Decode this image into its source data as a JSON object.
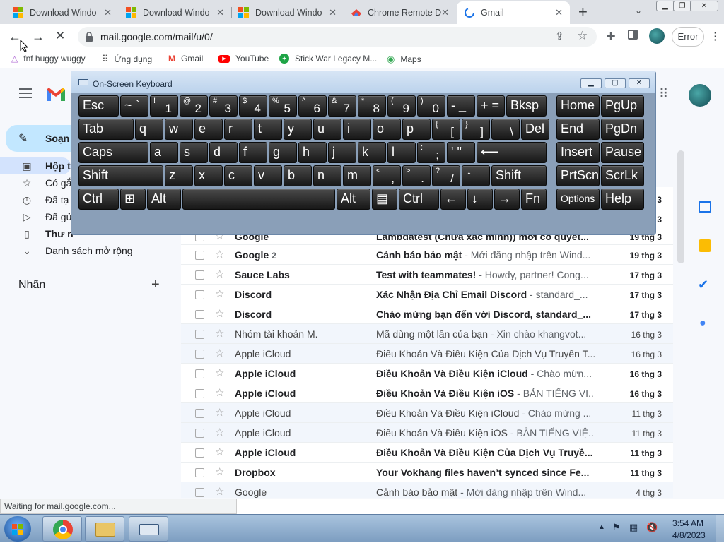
{
  "tabs": [
    {
      "title": "Download Windo",
      "icon": "windows-logo-icon"
    },
    {
      "title": "Download Windo",
      "icon": "windows-logo-icon"
    },
    {
      "title": "Download Windo",
      "icon": "windows-logo-icon"
    },
    {
      "title": "Chrome Remote D",
      "icon": "chrome-remote-icon"
    },
    {
      "title": "Gmail",
      "icon": "loading-spinner-icon"
    }
  ],
  "new_tab": "+",
  "toolbar": {
    "url": "mail.google.com/mail/u/0/",
    "profile_button": "Error"
  },
  "bookmarks": [
    {
      "label": "fnf huggy wuggy",
      "icon": "triangle-icon"
    },
    {
      "label": "Ứng dụng",
      "icon": "apps-grid-icon"
    },
    {
      "label": "Gmail",
      "icon": "gmail-icon"
    },
    {
      "label": "YouTube",
      "icon": "youtube-icon"
    },
    {
      "label": "Stick War Legacy M...",
      "icon": "game-icon"
    },
    {
      "label": "Maps",
      "icon": "maps-icon"
    }
  ],
  "gmail": {
    "compose": "Soạn",
    "nav": [
      {
        "label": "Hộp t",
        "icon": "inbox-icon",
        "bold": true
      },
      {
        "label": "Có gắ",
        "icon": "star-icon"
      },
      {
        "label": "Đã tạ",
        "icon": "clock-icon"
      },
      {
        "label": "Đã gử",
        "icon": "send-icon"
      },
      {
        "label": "Thư n",
        "icon": "draft-icon",
        "bold": true
      },
      {
        "label": "Danh sách mở rộng",
        "icon": "chevron-down-icon"
      }
    ],
    "labels_heading": "Nhãn",
    "partial_top_rows": [
      {
        "snd": "Google",
        "msg": "Lambdatest (Chưa xác minh)) mời cô quyết...",
        "dt": "19 thg 3"
      }
    ],
    "emails": [
      {
        "sender": "Google",
        "count": "2",
        "subject": "Cảnh báo bảo mật",
        "preview": " - Mới đăng nhập trên Wind...",
        "date": "19 thg 3",
        "unread": true
      },
      {
        "sender": "Sauce Labs",
        "count": "",
        "subject": "Test with teammates!",
        "preview": " - Howdy, partner! Cong...",
        "date": "17 thg 3",
        "unread": true
      },
      {
        "sender": "Discord",
        "count": "",
        "subject": "Xác Nhận Địa Chỉ Email Discord",
        "preview": " - standard_...",
        "date": "17 thg 3",
        "unread": true
      },
      {
        "sender": "Discord",
        "count": "",
        "subject": "Chào mừng bạn đến với Discord, standard_...",
        "preview": "",
        "date": "17 thg 3",
        "unread": true
      },
      {
        "sender": "Nhóm tài khoản M.",
        "count": "",
        "subject": "Mã dùng một lần của bạn",
        "preview": " - Xin chào khangvot...",
        "date": "16 thg 3",
        "unread": false
      },
      {
        "sender": "Apple iCloud",
        "count": "",
        "subject": "Điều Khoản Và Điều Kiện Của Dịch Vụ Truyền T...",
        "preview": "",
        "date": "16 thg 3",
        "unread": false
      },
      {
        "sender": "Apple iCloud",
        "count": "",
        "subject": "Điều Khoản Và Điều Kiện iCloud",
        "preview": " - Chào mừn...",
        "date": "16 thg 3",
        "unread": true
      },
      {
        "sender": "Apple iCloud",
        "count": "",
        "subject": "Điều Khoản Và Điều Kiện iOS",
        "preview": " - BẢN TIẾNG VI...",
        "date": "16 thg 3",
        "unread": true
      },
      {
        "sender": "Apple iCloud",
        "count": "",
        "subject": "Điều Khoản Và Điều Kiện iCloud",
        "preview": " - Chào mừng ...",
        "date": "11 thg 3",
        "unread": false
      },
      {
        "sender": "Apple iCloud",
        "count": "",
        "subject": "Điều Khoản Và Điều Kiện iOS",
        "preview": " - BẢN TIẾNG VIỆ...",
        "date": "11 thg 3",
        "unread": false
      },
      {
        "sender": "Apple iCloud",
        "count": "",
        "subject": "Điều Khoản Và Điều Kiện Của Dịch Vụ Truyề...",
        "preview": "",
        "date": "11 thg 3",
        "unread": true
      },
      {
        "sender": "Dropbox",
        "count": "",
        "subject": "Your Vokhang files haven’t synced since Fe...",
        "preview": "",
        "date": "11 thg 3",
        "unread": true
      },
      {
        "sender": "Google",
        "count": "",
        "subject": "Cảnh báo bảo mật",
        "preview": " - Mới đăng nhập trên Wind...",
        "date": "4 thg 3",
        "unread": false
      }
    ],
    "hidden_dates": [
      "17 thg 3",
      "17 thg 3",
      "17 thg 3"
    ]
  },
  "osk": {
    "title": "On-Screen Keyboard",
    "rows": [
      [
        [
          "Esc",
          ""
        ],
        [
          "~ `",
          ""
        ],
        [
          "1",
          "!"
        ],
        [
          "2",
          "@"
        ],
        [
          "3",
          "#"
        ],
        [
          "4",
          "$"
        ],
        [
          "5",
          "%"
        ],
        [
          "6",
          "^"
        ],
        [
          "7",
          "&"
        ],
        [
          "8",
          "*"
        ],
        [
          "9",
          "("
        ],
        [
          "0",
          ")"
        ],
        [
          "- _",
          ""
        ],
        [
          "+ =",
          ""
        ],
        [
          "Bksp",
          ""
        ],
        [
          "Home",
          ""
        ],
        [
          "PgUp",
          ""
        ]
      ],
      [
        [
          "Tab",
          ""
        ],
        [
          "q",
          ""
        ],
        [
          "w",
          ""
        ],
        [
          "e",
          ""
        ],
        [
          "r",
          ""
        ],
        [
          "t",
          ""
        ],
        [
          "y",
          ""
        ],
        [
          "u",
          ""
        ],
        [
          "i",
          ""
        ],
        [
          "o",
          ""
        ],
        [
          "p",
          ""
        ],
        [
          "[",
          "{"
        ],
        [
          "]",
          "}"
        ],
        [
          "\\",
          "|"
        ],
        [
          "Del",
          ""
        ],
        [
          "End",
          ""
        ],
        [
          "PgDn",
          ""
        ]
      ],
      [
        [
          "Caps",
          ""
        ],
        [
          "a",
          ""
        ],
        [
          "s",
          ""
        ],
        [
          "d",
          ""
        ],
        [
          "f",
          ""
        ],
        [
          "g",
          ""
        ],
        [
          "h",
          ""
        ],
        [
          "j",
          ""
        ],
        [
          "k",
          ""
        ],
        [
          "l",
          ""
        ],
        [
          ";",
          ":"
        ],
        [
          "' \"",
          ""
        ],
        [
          "⟵",
          ""
        ],
        [
          "Insert",
          ""
        ],
        [
          "Pause",
          ""
        ]
      ],
      [
        [
          "Shift",
          ""
        ],
        [
          "z",
          ""
        ],
        [
          "x",
          ""
        ],
        [
          "c",
          ""
        ],
        [
          "v",
          ""
        ],
        [
          "b",
          ""
        ],
        [
          "n",
          ""
        ],
        [
          "m",
          ""
        ],
        [
          ",",
          "<"
        ],
        [
          ".",
          ">"
        ],
        [
          "/",
          "?"
        ],
        [
          "↑",
          ""
        ],
        [
          "Shift",
          ""
        ],
        [
          "PrtScn",
          ""
        ],
        [
          "ScrLk",
          ""
        ]
      ],
      [
        [
          "Ctrl",
          ""
        ],
        [
          "⊞",
          ""
        ],
        [
          "Alt",
          ""
        ],
        [
          "",
          ""
        ],
        [
          "Alt",
          ""
        ],
        [
          "▤",
          ""
        ],
        [
          "Ctrl",
          ""
        ],
        [
          "←",
          ""
        ],
        [
          "↓",
          ""
        ],
        [
          "→",
          ""
        ],
        [
          "Fn",
          ""
        ],
        [
          "Options",
          ""
        ],
        [
          "Help",
          ""
        ]
      ]
    ]
  },
  "status_text": "Waiting for mail.google.com...",
  "clock": {
    "time": "3:54 AM",
    "date": "4/8/2023"
  }
}
